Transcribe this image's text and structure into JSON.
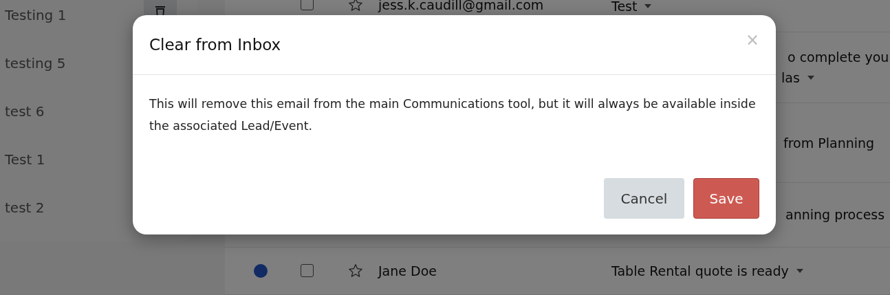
{
  "sidebar": {
    "items": [
      {
        "label": "Testing 1",
        "delete_button": true
      },
      {
        "label": "testing 5"
      },
      {
        "label": "test 6"
      },
      {
        "label": "Test 1"
      },
      {
        "label": "test 2"
      }
    ]
  },
  "inbox": {
    "rows": [
      {
        "unread": false,
        "checked": false,
        "starred": false,
        "sender": "jess.k.caudill@gmail.com",
        "subject_lines": [
          "Test"
        ],
        "caret": true
      },
      {
        "subject_lines": [
          "o complete you",
          "las"
        ],
        "caret": true
      },
      {
        "subject_lines": [
          "from Planning"
        ]
      },
      {
        "subject_lines": [
          "anning process"
        ]
      },
      {
        "unread": true,
        "checked": false,
        "starred": false,
        "sender": "Jane Doe",
        "subject_lines": [
          "Table Rental quote is ready"
        ],
        "caret": true
      }
    ]
  },
  "modal": {
    "title": "Clear from Inbox",
    "close": "×",
    "body": "This will remove this email from the main Communications tool, but it will always be available inside the associated Lead/Event.",
    "buttons": [
      {
        "label": "Cancel",
        "kind": "secondary"
      },
      {
        "label": "Save",
        "kind": "primary"
      }
    ]
  }
}
